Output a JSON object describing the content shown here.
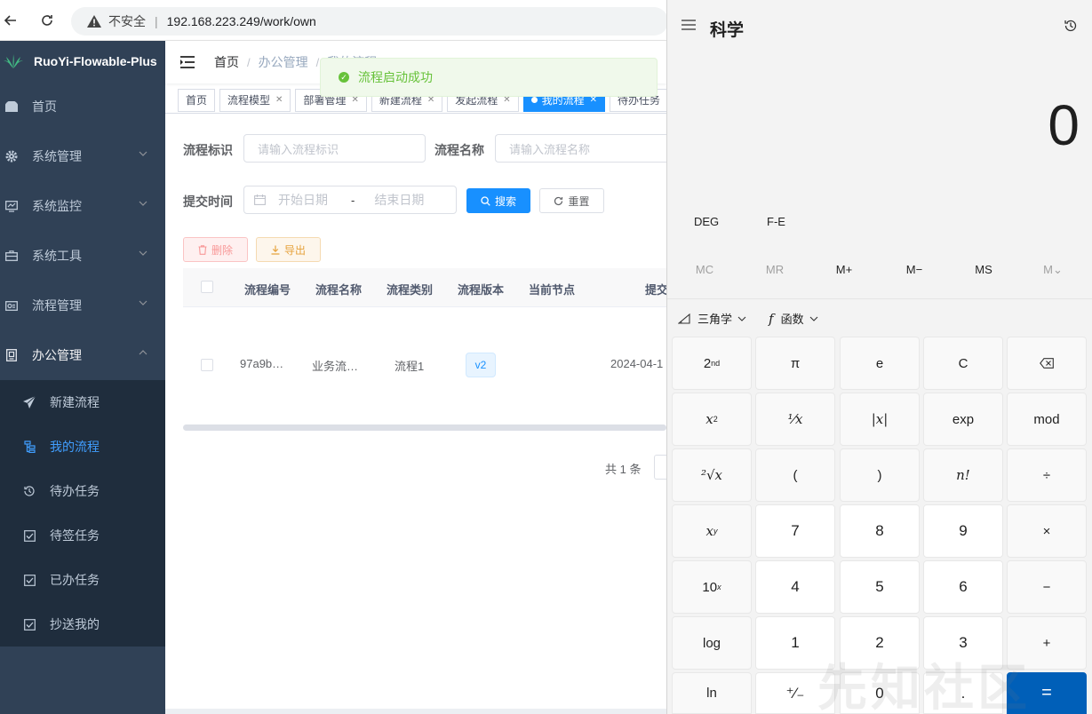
{
  "browser": {
    "security_label": "不安全",
    "url": "192.168.223.249/work/own"
  },
  "app": {
    "logo_text": "RuoYi-Flowable-Plus"
  },
  "sidebar": {
    "items": [
      {
        "label": "首页"
      },
      {
        "label": "系统管理"
      },
      {
        "label": "系统监控"
      },
      {
        "label": "系统工具"
      },
      {
        "label": "流程管理"
      },
      {
        "label": "办公管理"
      }
    ],
    "subitems": [
      {
        "label": "新建流程"
      },
      {
        "label": "我的流程"
      },
      {
        "label": "待办任务"
      },
      {
        "label": "待签任务"
      },
      {
        "label": "已办任务"
      },
      {
        "label": "抄送我的"
      }
    ]
  },
  "navbar": {
    "crumb_home": "首页",
    "crumb_office": "办公管理",
    "crumb_current": "我的流程"
  },
  "tags": [
    {
      "label": "首页"
    },
    {
      "label": "流程模型"
    },
    {
      "label": "部署管理"
    },
    {
      "label": "新建流程"
    },
    {
      "label": "发起流程"
    },
    {
      "label": "我的流程"
    },
    {
      "label": "待办任务"
    }
  ],
  "toast": {
    "message": "流程启动成功"
  },
  "search": {
    "key_label": "流程标识",
    "key_placeholder": "请输入流程标识",
    "name_label": "流程名称",
    "name_placeholder": "请输入流程名称",
    "time_label": "提交时间",
    "start_placeholder": "开始日期",
    "range_sep": "-",
    "end_placeholder": "结束日期",
    "search_btn": "搜索",
    "reset_btn": "重置"
  },
  "toolbar": {
    "delete_btn": "删除",
    "export_btn": "导出"
  },
  "table": {
    "headers": [
      "流程编号",
      "流程名称",
      "流程类别",
      "流程版本",
      "当前节点",
      "提交"
    ],
    "row": {
      "id": "97a9b…",
      "name": "业务流…",
      "category": "流程1",
      "version": "v2",
      "submit_time": "2024-04-1"
    }
  },
  "pagination": {
    "total": "共 1 条"
  },
  "calculator": {
    "title": "科学",
    "display": "0",
    "modes": [
      "DEG",
      "F-E"
    ],
    "memory": [
      "MC",
      "MR",
      "M+",
      "M−",
      "MS",
      "M⌄"
    ],
    "trig_label": "三角学",
    "func_label": "函数",
    "keys": {
      "second": "2",
      "second_sup": "nd",
      "pi": "π",
      "e": "e",
      "clear": "C",
      "x": "x",
      "sq_sup": "2",
      "inv": "¹⁄x",
      "abs": "|x|",
      "exp": "exp",
      "mod": "mod",
      "sqrt": "²√x",
      "lparen": "(",
      "rparen": ")",
      "fact": "n!",
      "div": "÷",
      "pow_sup": "y",
      "mul": "×",
      "ten": "10",
      "tenx_sup": "x",
      "minus": "−",
      "log": "log",
      "plus": "+",
      "ln": "ln",
      "negate": "⁺⁄₋",
      "dot": ".",
      "equals": "=",
      "digits": [
        "7",
        "8",
        "9",
        "4",
        "5",
        "6",
        "1",
        "2",
        "3",
        "0"
      ]
    }
  },
  "watermark": "先知社区",
  "colors": {
    "sidebar": "#304156",
    "accent": "#1890ff",
    "success": "#67c23a",
    "calc_equals": "#005fb8"
  }
}
